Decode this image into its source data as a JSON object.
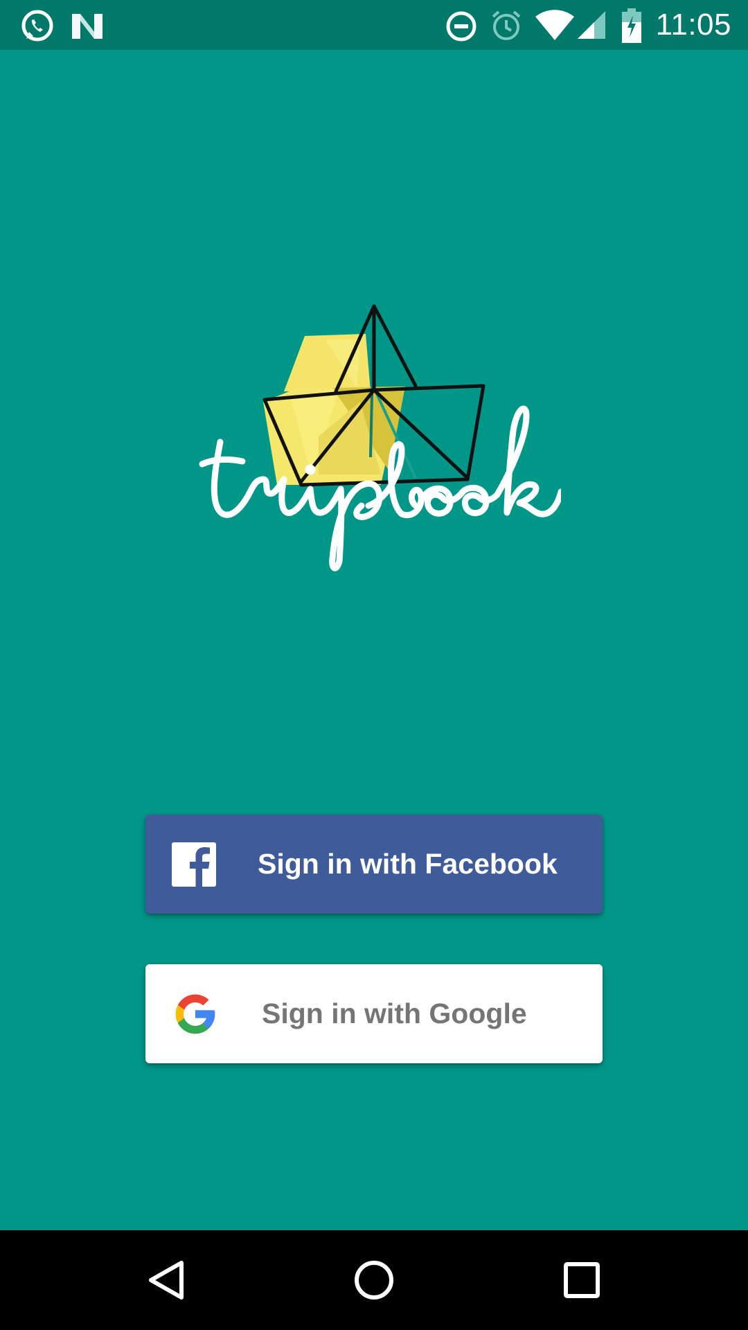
{
  "status_bar": {
    "time": "11:05",
    "icons": [
      "whatsapp-icon",
      "n-preview-icon",
      "do-not-disturb-icon",
      "alarm-icon",
      "wifi-icon",
      "cellular-signal-icon",
      "battery-charging-icon"
    ]
  },
  "logo": {
    "text": "tripbook",
    "colors": {
      "sail": "#f4e46a",
      "outline": "#111111",
      "script": "#ffffff"
    }
  },
  "buttons": {
    "facebook": {
      "label": "Sign in with Facebook",
      "icon": "facebook-icon",
      "background": "#3f5b99"
    },
    "google": {
      "label": "Sign in with Google",
      "icon": "google-icon",
      "background": "#ffffff"
    }
  },
  "navigation_bar": {
    "buttons": [
      "back-icon",
      "home-icon",
      "recents-icon"
    ]
  },
  "colors": {
    "background": "#009688",
    "status_bar": "#00796b",
    "navigation_bar": "#000000"
  }
}
